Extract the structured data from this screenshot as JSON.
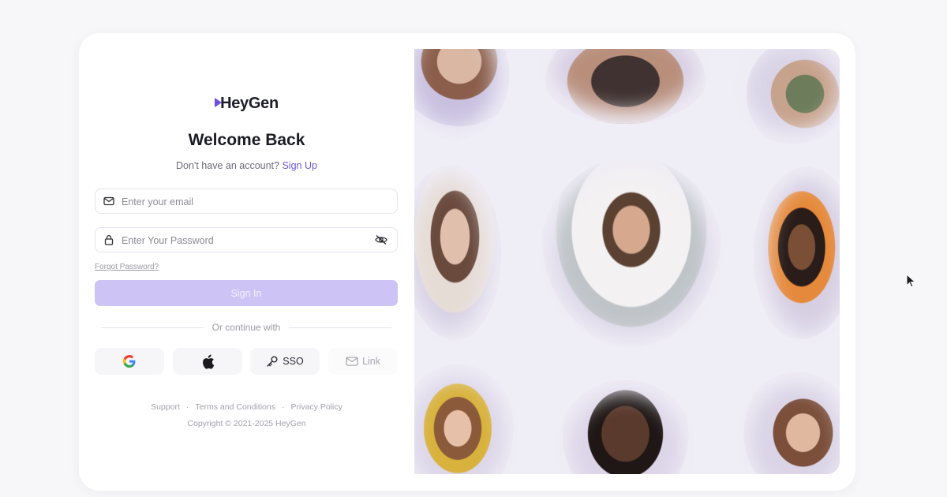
{
  "brand": {
    "name": "HeyGen",
    "accent": "#6e58d8",
    "button_bg": "#cdc4f5"
  },
  "heading": "Welcome Back",
  "signup_prompt": {
    "text": "Don't have an account?",
    "link": "Sign Up"
  },
  "email": {
    "placeholder": "Enter your email",
    "value": ""
  },
  "password": {
    "placeholder": "Enter Your Password",
    "value": ""
  },
  "forgot_link": "Forgot Password?",
  "signin_label": "Sign In",
  "divider_text": "Or continue with",
  "social": {
    "sso_label": "SSO",
    "link_label": "Link"
  },
  "footer": {
    "links": [
      "Support",
      "Terms and Conditions",
      "Privacy Policy"
    ],
    "copyright": "Copyright © 2021-2025 HeyGen"
  }
}
